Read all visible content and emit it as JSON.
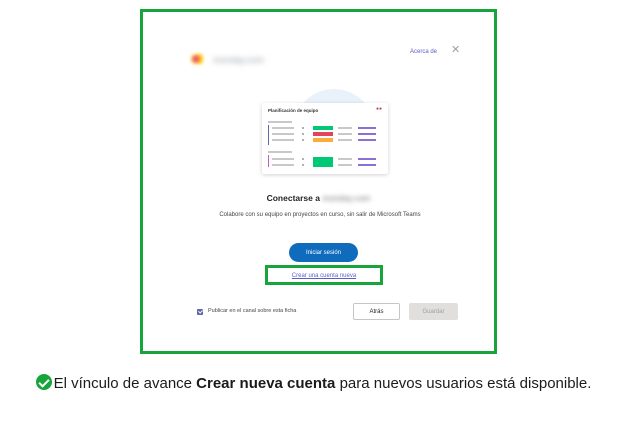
{
  "dialog": {
    "app_name": "monday.com",
    "about_link": "Acerca de",
    "close_glyph": "✕",
    "card": {
      "title": "Planificación de equipo",
      "status_colors": [
        "#00c875",
        "#e2445c",
        "#fdab3d",
        "#00c875"
      ]
    },
    "connect_title": "Conectarse a",
    "connect_target": "monday.com",
    "description": "Colabore con su equipo en proyectos en curso, sin salir de Microsoft Teams",
    "signin_button": "Iniciar sesión",
    "create_account_link": "Crear una cuenta nueva",
    "post_checkbox": {
      "label": "Publicar en el canal sobre esta ficha",
      "checked": true
    },
    "back_button": "Atrás",
    "save_button": "Guardar"
  },
  "caption": {
    "prefix": "El vínculo de avance ",
    "bold": "Crear nueva cuenta",
    "suffix": " para nuevos usuarios está disponible."
  },
  "colors": {
    "highlight": "#17a43b",
    "primary": "#0f6cbd",
    "link": "#5b5fc7"
  }
}
